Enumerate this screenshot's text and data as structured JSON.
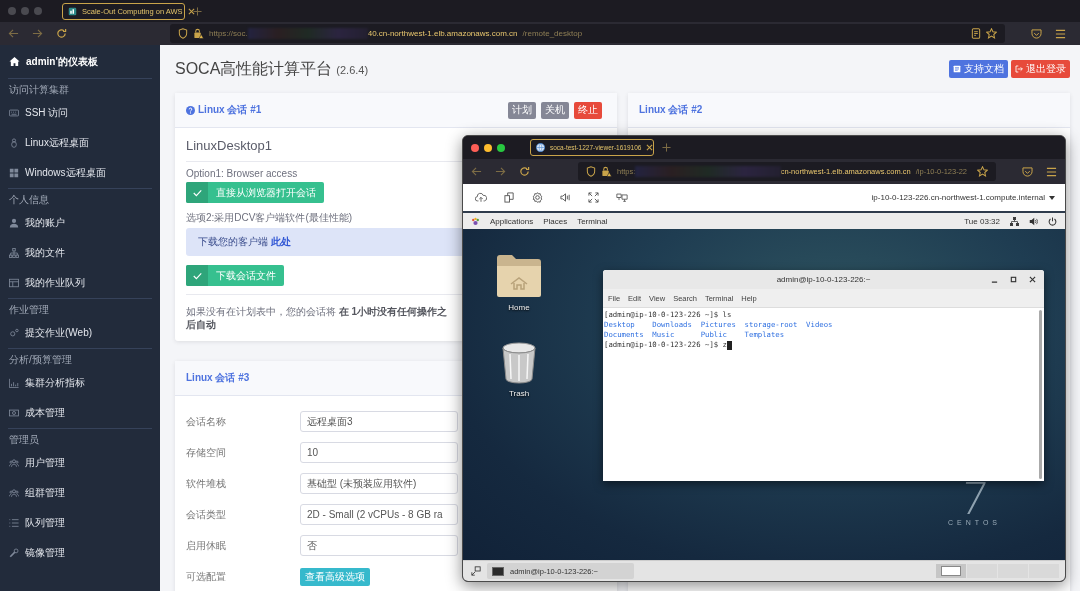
{
  "browser": {
    "tab": {
      "title": "Scale-Out Computing on AWS"
    },
    "url": {
      "prefix": "https://soc.",
      "host": "40.cn-northwest-1.elb.amazonaws.com.cn",
      "path": "/remote_desktop"
    }
  },
  "sidebar": {
    "home": {
      "label": "admin'的仪表板"
    },
    "sections": [
      {
        "title": "访问计算集群",
        "items": [
          {
            "label": "SSH 访问"
          },
          {
            "label": "Linux远程桌面"
          },
          {
            "label": "Windows远程桌面"
          }
        ]
      },
      {
        "title": "个人信息",
        "items": [
          {
            "label": "我的账户"
          },
          {
            "label": "我的文件"
          },
          {
            "label": "我的作业队列"
          }
        ]
      },
      {
        "title": "作业管理",
        "items": [
          {
            "label": "提交作业(Web)"
          }
        ]
      },
      {
        "title": "分析/预算管理",
        "items": [
          {
            "label": "集群分析指标"
          },
          {
            "label": "成本管理"
          }
        ]
      },
      {
        "title": "管理员",
        "items": [
          {
            "label": "用户管理"
          },
          {
            "label": "组群管理"
          },
          {
            "label": "队列管理"
          },
          {
            "label": "镜像管理"
          }
        ]
      }
    ]
  },
  "page": {
    "title": "SOCA高性能计算平台",
    "version": "(2.6.4)",
    "buttons": [
      {
        "label": "支持文档",
        "kind": "primary"
      },
      {
        "label": "退出登录",
        "kind": "danger"
      }
    ]
  },
  "session_1": {
    "title": "Linux 会话 #1",
    "help_icon": true,
    "actions": [
      {
        "label": "计划",
        "kind": "secondary"
      },
      {
        "label": "关机",
        "kind": "secondary"
      },
      {
        "label": "终止",
        "kind": "danger"
      }
    ],
    "name": "LinuxDesktop1",
    "option1": "Option1: Browser access",
    "open_button": "直接从浏览器打开会话",
    "option2": "选项2:采用DCV客户端软件(最佳性能)",
    "client_alert": {
      "text": "下载您的客户端",
      "link": "此处"
    },
    "download_button": "下载会话文件",
    "note": "如果没有在计划表中，您的会话将 **在 1小时没有任何操作之后自动**"
  },
  "session_2": {
    "title": "Linux 会话 #2"
  },
  "session_3": {
    "title": "Linux 会话 #3",
    "fields": [
      {
        "label": "会话名称",
        "value": "远程桌面3",
        "kind": "input"
      },
      {
        "label": "存储空间",
        "value": "10",
        "kind": "input"
      },
      {
        "label": "软件堆栈",
        "value": "基础型 (未预装应用软件)",
        "kind": "select"
      },
      {
        "label": "会话类型",
        "value": "2D - Small (2 vCPUs - 8 GB ra",
        "kind": "select"
      },
      {
        "label": "启用休眠",
        "value": "否",
        "kind": "select"
      },
      {
        "label": "可选配置",
        "value": "查看高级选项",
        "kind": "button"
      }
    ]
  },
  "viewer": {
    "tab": {
      "title": "soca-test-1227-viewer-1619106"
    },
    "url": {
      "prefix": "https:",
      "host": "cn-northwest-1.elb.amazonaws.com.cn",
      "path": "/ip-10-0-123-22"
    },
    "host_menu": "ip-10-0-123-226.cn-northwest-1.compute.internal",
    "topbar": {
      "menus": [
        "Applications",
        "Places",
        "Terminal"
      ],
      "clock": "Tue 03:32"
    },
    "desktop_icons": [
      {
        "label": "Home",
        "kind": "folder"
      },
      {
        "label": "Trash",
        "kind": "trash"
      }
    ],
    "logo": {
      "number": "7",
      "name": "CENTOS"
    },
    "terminal": {
      "title": "admin@ip-10-0-123-226:~",
      "menus": [
        "File",
        "Edit",
        "View",
        "Search",
        "Terminal",
        "Help"
      ],
      "lines": [
        {
          "kind": "command",
          "text": "[admin@ip-10-0-123-226 ~]$ ls"
        },
        {
          "kind": "files",
          "entries": [
            "Desktop",
            "Downloads",
            "Pictures",
            "storage-root",
            "Videos",
            "Documents",
            "Music",
            "Public",
            "Templates"
          ]
        },
        {
          "kind": "command",
          "text": "[admin@ip-10-0-123-226 ~]$ z",
          "cursor": true
        }
      ]
    },
    "taskbar": {
      "tasks": [
        {
          "label": "admin@ip-10-0-123-226:~"
        }
      ],
      "workspaces": [
        {
          "selected": true
        },
        {
          "selected": false
        },
        {
          "selected": false
        },
        {
          "selected": false
        }
      ]
    }
  }
}
